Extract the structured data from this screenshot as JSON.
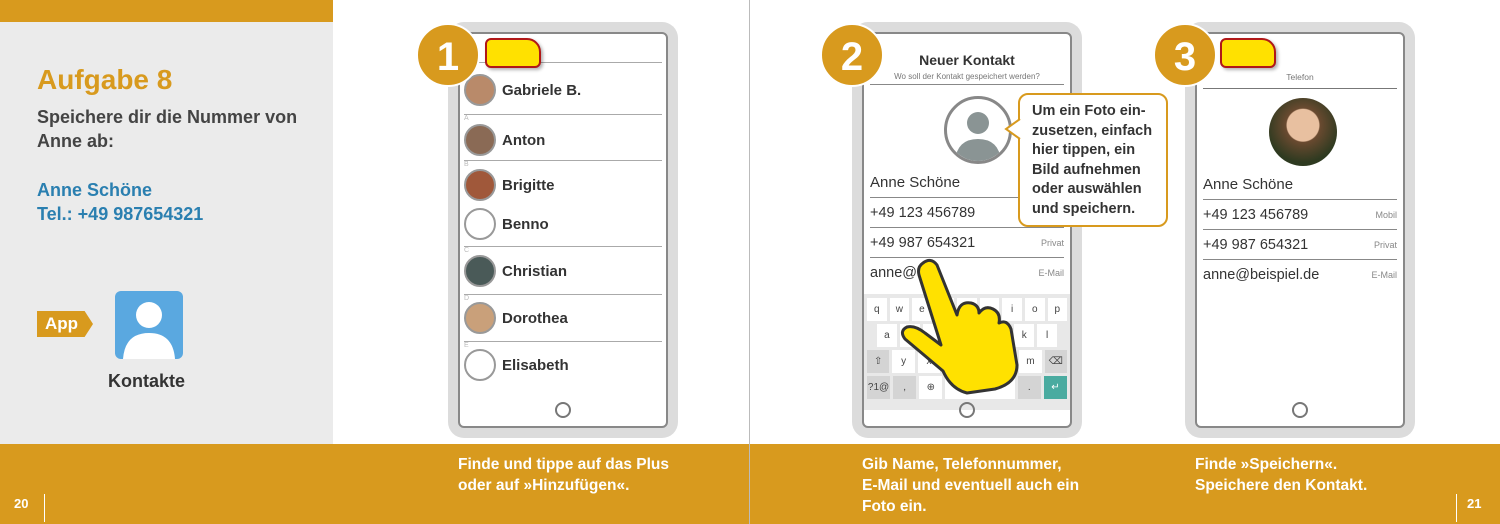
{
  "left_panel": {
    "title": "Aufgabe 8",
    "intro": [
      "Speichere dir die Nummer von",
      "Anne ab:"
    ],
    "contact_name": "Anne Schöne",
    "contact_phone": "Tel.: +49 987654321",
    "app_badge": "App",
    "app_name": "Kontakte",
    "app_icon": "contacts-person-icon"
  },
  "colors": {
    "accent": "#d89a1e",
    "blue": "#2a7fb0",
    "app_icon": "#5aa8e0",
    "plus_button": "#ffe100"
  },
  "footer": {
    "page_left": "20",
    "page_right": "21",
    "captions": [
      [
        "Finde und tippe auf das Plus",
        "oder auf »Hinzufügen«."
      ],
      [
        "Gib Name, Telefonnummer,",
        "E-Mail und eventuell auch ein",
        "Foto ein."
      ],
      [
        "Finde »Speichern«.",
        "Speichere den Kontakt."
      ]
    ]
  },
  "steps": [
    "1",
    "2",
    "3"
  ],
  "phone1": {
    "contacts": [
      {
        "name": "Gabriele B.",
        "section": ""
      },
      {
        "name": "Anton",
        "section": "A"
      },
      {
        "name": "Brigitte",
        "section": "B"
      },
      {
        "name": "Benno",
        "section": ""
      },
      {
        "name": "Christian",
        "section": "C"
      },
      {
        "name": "Dorothea",
        "section": "D"
      },
      {
        "name": "Elisabeth",
        "section": "E"
      }
    ]
  },
  "phone2": {
    "title": "Neuer Kontakt",
    "subtitle": "Wo soll der Kontakt gespeichert werden?",
    "name": "Anne Schöne",
    "phone_mobile": "+49 123 456789",
    "phone_private": "+49 987 654321",
    "label_private": "Privat",
    "email": "anne@",
    "label_email": "E-Mail",
    "keyboard": [
      [
        "q",
        "w",
        "e",
        "",
        "",
        "",
        "i",
        "o",
        "p"
      ],
      [
        "a",
        "",
        "",
        "",
        "",
        "",
        "k",
        "l"
      ],
      [
        "⇧",
        "y",
        "x",
        "",
        "",
        "",
        "m",
        "⌫"
      ],
      [
        "?1@",
        ",",
        "⊕",
        "",
        "",
        ".",
        "↵"
      ]
    ],
    "tooltip": [
      "Um ein Foto ein-",
      "zusetzen, einfach",
      "hier tippen, ein",
      "Bild aufnehmen",
      "oder auswählen",
      "und speichern."
    ]
  },
  "phone3": {
    "header": "Telefon",
    "name": "Anne Schöne",
    "phone_mobile": "+49 123 456789",
    "label_mobile": "Mobil",
    "phone_private": "+49 987 654321",
    "label_private": "Privat",
    "email": "anne@beispiel.de",
    "label_email": "E-Mail"
  }
}
